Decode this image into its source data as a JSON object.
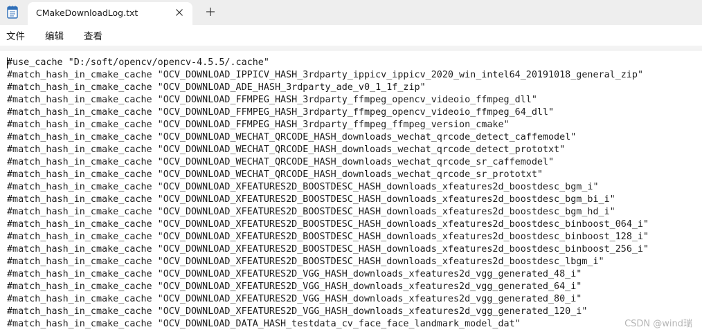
{
  "window": {
    "tab_title": "CMakeDownloadLog.txt",
    "icons": {
      "app": "notepad-icon",
      "close": "close-icon",
      "new_tab": "plus-icon"
    }
  },
  "menu": {
    "items": [
      "文件",
      "编辑",
      "查看"
    ]
  },
  "editor": {
    "lines": [
      "#use_cache \"D:/soft/opencv/opencv-4.5.5/.cache\"",
      "#match_hash_in_cmake_cache \"OCV_DOWNLOAD_IPPICV_HASH_3rdparty_ippicv_ippicv_2020_win_intel64_20191018_general_zip\"",
      "#match_hash_in_cmake_cache \"OCV_DOWNLOAD_ADE_HASH_3rdparty_ade_v0_1_1f_zip\"",
      "#match_hash_in_cmake_cache \"OCV_DOWNLOAD_FFMPEG_HASH_3rdparty_ffmpeg_opencv_videoio_ffmpeg_dll\"",
      "#match_hash_in_cmake_cache \"OCV_DOWNLOAD_FFMPEG_HASH_3rdparty_ffmpeg_opencv_videoio_ffmpeg_64_dll\"",
      "#match_hash_in_cmake_cache \"OCV_DOWNLOAD_FFMPEG_HASH_3rdparty_ffmpeg_ffmpeg_version_cmake\"",
      "#match_hash_in_cmake_cache \"OCV_DOWNLOAD_WECHAT_QRCODE_HASH_downloads_wechat_qrcode_detect_caffemodel\"",
      "#match_hash_in_cmake_cache \"OCV_DOWNLOAD_WECHAT_QRCODE_HASH_downloads_wechat_qrcode_detect_prototxt\"",
      "#match_hash_in_cmake_cache \"OCV_DOWNLOAD_WECHAT_QRCODE_HASH_downloads_wechat_qrcode_sr_caffemodel\"",
      "#match_hash_in_cmake_cache \"OCV_DOWNLOAD_WECHAT_QRCODE_HASH_downloads_wechat_qrcode_sr_prototxt\"",
      "#match_hash_in_cmake_cache \"OCV_DOWNLOAD_XFEATURES2D_BOOSTDESC_HASH_downloads_xfeatures2d_boostdesc_bgm_i\"",
      "#match_hash_in_cmake_cache \"OCV_DOWNLOAD_XFEATURES2D_BOOSTDESC_HASH_downloads_xfeatures2d_boostdesc_bgm_bi_i\"",
      "#match_hash_in_cmake_cache \"OCV_DOWNLOAD_XFEATURES2D_BOOSTDESC_HASH_downloads_xfeatures2d_boostdesc_bgm_hd_i\"",
      "#match_hash_in_cmake_cache \"OCV_DOWNLOAD_XFEATURES2D_BOOSTDESC_HASH_downloads_xfeatures2d_boostdesc_binboost_064_i\"",
      "#match_hash_in_cmake_cache \"OCV_DOWNLOAD_XFEATURES2D_BOOSTDESC_HASH_downloads_xfeatures2d_boostdesc_binboost_128_i\"",
      "#match_hash_in_cmake_cache \"OCV_DOWNLOAD_XFEATURES2D_BOOSTDESC_HASH_downloads_xfeatures2d_boostdesc_binboost_256_i\"",
      "#match_hash_in_cmake_cache \"OCV_DOWNLOAD_XFEATURES2D_BOOSTDESC_HASH_downloads_xfeatures2d_boostdesc_lbgm_i\"",
      "#match_hash_in_cmake_cache \"OCV_DOWNLOAD_XFEATURES2D_VGG_HASH_downloads_xfeatures2d_vgg_generated_48_i\"",
      "#match_hash_in_cmake_cache \"OCV_DOWNLOAD_XFEATURES2D_VGG_HASH_downloads_xfeatures2d_vgg_generated_64_i\"",
      "#match_hash_in_cmake_cache \"OCV_DOWNLOAD_XFEATURES2D_VGG_HASH_downloads_xfeatures2d_vgg_generated_80_i\"",
      "#match_hash_in_cmake_cache \"OCV_DOWNLOAD_XFEATURES2D_VGG_HASH_downloads_xfeatures2d_vgg_generated_120_i\"",
      "#match_hash_in_cmake_cache \"OCV_DOWNLOAD_DATA_HASH_testdata_cv_face_face_landmark_model_dat\""
    ]
  },
  "watermark": "CSDN @wind瑞",
  "colors": {
    "titlebar_bg": "#eeeeee",
    "editor_bg": "#ffffff",
    "text": "#1e1e1e",
    "app_icon_accent": "#2f6fb8"
  }
}
